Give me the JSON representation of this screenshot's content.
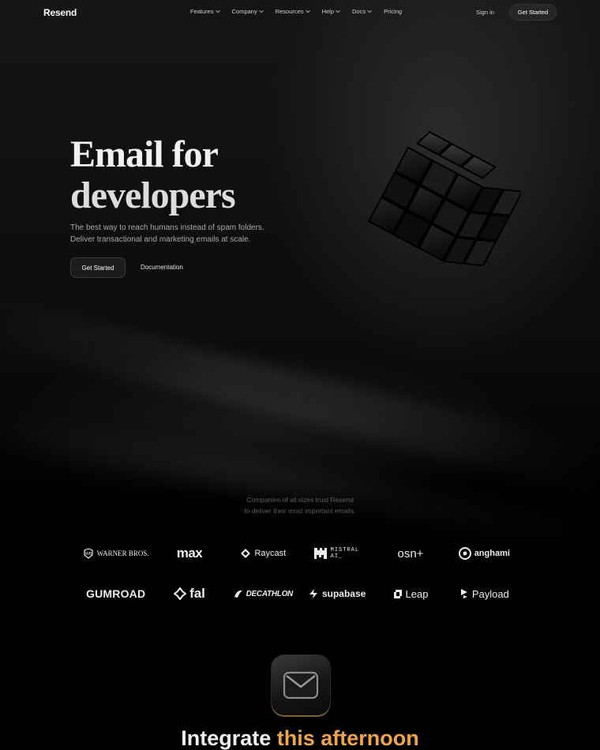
{
  "nav": {
    "logo": "Resend",
    "links": [
      {
        "label": "Features",
        "has_dropdown": true
      },
      {
        "label": "Company",
        "has_dropdown": true
      },
      {
        "label": "Resources",
        "has_dropdown": true
      },
      {
        "label": "Help",
        "has_dropdown": true
      },
      {
        "label": "Docs",
        "has_dropdown": true
      },
      {
        "label": "Pricing",
        "has_dropdown": false
      }
    ],
    "sign_in": "Sign in",
    "cta": "Get Started"
  },
  "hero": {
    "title_line1": "Email for",
    "title_line2": "developers",
    "subtitle_line1": "The best way to reach humans instead of spam folders.",
    "subtitle_line2": "Deliver transactional and marketing emails at scale.",
    "primary_button": "Get Started",
    "secondary_button": "Documentation"
  },
  "trust": {
    "line1": "Companies of all sizes trust Resend",
    "line2": "to deliver their most important emails.",
    "logos_row1": [
      "WARNER BROS.",
      "max",
      "Raycast",
      "MISTRAL AI_",
      "osn+",
      "anghami"
    ],
    "logos_row2": [
      "GUMROAD",
      "fal",
      "DECATHLON",
      "supabase",
      "Leap",
      "Payload"
    ]
  },
  "integrate": {
    "prefix": "Integrate",
    "accent": "this afternoon"
  },
  "colors": {
    "background": "#000000",
    "accent": "#f2a53a",
    "muted_text": "#a9a9a9"
  },
  "icons": [
    "chevron-down-icon",
    "mail-icon",
    "cube-graphic"
  ]
}
